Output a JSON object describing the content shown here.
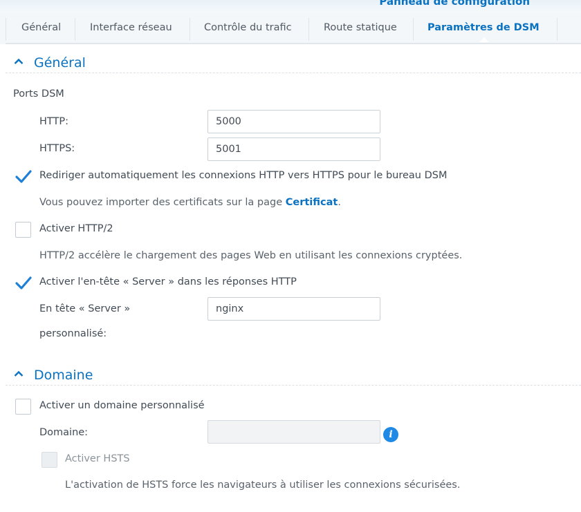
{
  "window": {
    "title": "Panneau de configuration"
  },
  "tabs": [
    {
      "label": "Général"
    },
    {
      "label": "Interface réseau"
    },
    {
      "label": "Contrôle du trafic"
    },
    {
      "label": "Route statique"
    },
    {
      "label": "Paramètres de DSM",
      "active": true
    }
  ],
  "general": {
    "heading": "Général",
    "ports_label": "Ports DSM",
    "http_label": "HTTP:",
    "http_value": "5000",
    "https_label": "HTTPS:",
    "https_value": "5001",
    "redirect": {
      "label": "Rediriger automatiquement les connexions HTTP vers HTTPS pour le bureau DSM",
      "checked": true
    },
    "cert_note": {
      "before": "Vous pouvez importer des certificats sur la page ",
      "link": "Certificat",
      "after": "."
    },
    "http2": {
      "label": "Activer HTTP/2",
      "checked": false
    },
    "http2_note": "HTTP/2 accélère le chargement des pages Web en utilisant les connexions cryptées.",
    "server_header": {
      "label": "Activer l'en-tête « Server » dans les réponses HTTP",
      "checked": true
    },
    "custom_header_label_line1": "En tête « Server »",
    "custom_header_label_line2": "personnalisé:",
    "custom_header_value": "nginx"
  },
  "domain": {
    "heading": "Domaine",
    "custom_domain": {
      "label": "Activer un domaine personnalisé",
      "checked": false
    },
    "domain_label": "Domaine:",
    "domain_value": "",
    "hsts": {
      "label": "Activer HSTS",
      "checked": false,
      "disabled": true
    },
    "hsts_note": "L'activation de HSTS force les navigateurs à utiliser les connexions sécurisées."
  },
  "colors": {
    "accent": "#0a72c1",
    "info": "#1e8ae5",
    "text": "#414b55"
  },
  "icons": {
    "section_toggle": "chevron-up-icon",
    "checkbox_checked": "checkmark-icon",
    "info": "info-icon"
  }
}
